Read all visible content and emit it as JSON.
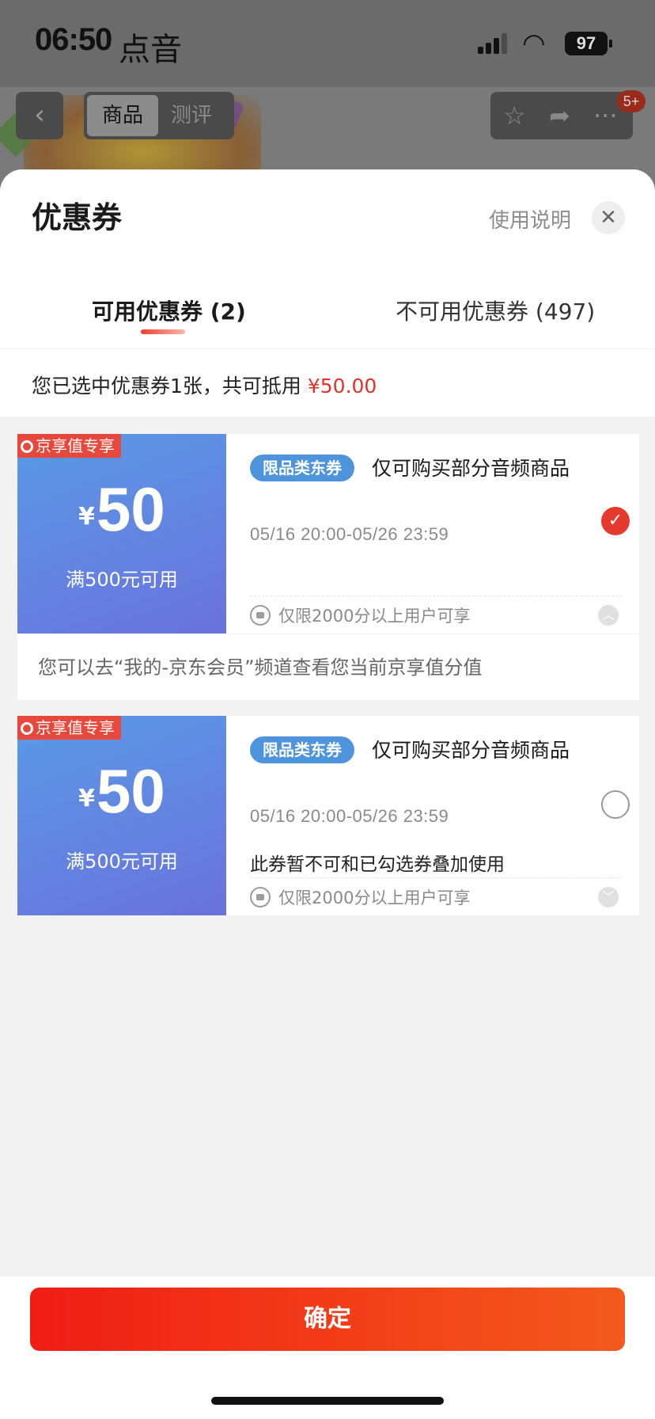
{
  "status_bar": {
    "time": "06:50",
    "app_name": "点音",
    "battery": "97"
  },
  "background_nav": {
    "tab_active": "商品",
    "tab_inactive": "测评",
    "notification_badge": "5+"
  },
  "sheet": {
    "title": "优惠券",
    "help_link": "使用说明",
    "tabs": [
      {
        "label": "可用优惠券 (2)",
        "active": true
      },
      {
        "label": "不可用优惠券 (497)",
        "active": false
      }
    ],
    "summary_text": "您已选中优惠券1张，共可抵用 ",
    "summary_amount": "¥50.00"
  },
  "coupons": [
    {
      "vip_tag": "京享值专享",
      "currency": "¥",
      "amount": "50",
      "threshold": "满500元可用",
      "type_badge": "限品类东券",
      "scope": "仅可购买部分音频商品",
      "validity": "05/16 20:00-05/26 23:59",
      "note": "",
      "limit": "仅限2000分以上用户可享",
      "selected": true,
      "expanded": true,
      "tip": "您可以去“我的-京东会员”频道查看您当前京享值分值"
    },
    {
      "vip_tag": "京享值专享",
      "currency": "¥",
      "amount": "50",
      "threshold": "满500元可用",
      "type_badge": "限品类东券",
      "scope": "仅可购买部分音频商品",
      "validity": "05/16 20:00-05/26 23:59",
      "note": "此券暂不可和已勾选券叠加使用",
      "limit": "仅限2000分以上用户可享",
      "selected": false,
      "expanded": false
    }
  ],
  "footer": {
    "confirm_label": "确定"
  },
  "colors": {
    "accent_red": "#e73a2f",
    "coupon_blue_start": "#5a9ae6",
    "coupon_blue_end": "#6a72dc"
  }
}
